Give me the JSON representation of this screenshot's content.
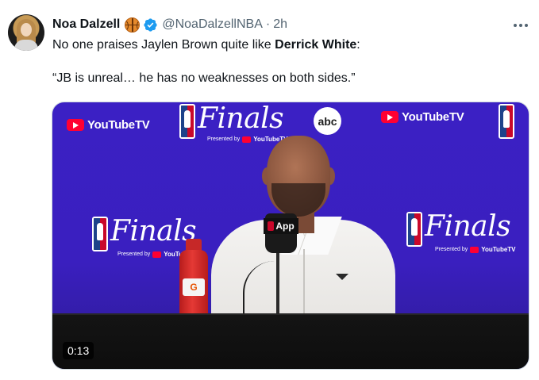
{
  "tweet": {
    "author": {
      "display_name": "Noa Dalzell",
      "handle": "@NoaDalzellNBA",
      "emoji": "basketball-icon",
      "verified": true
    },
    "timestamp": "2h",
    "separator": "·",
    "text_before_bold": "No one praises Jaylen Brown quite like ",
    "text_bold": "Derrick White",
    "text_after_bold": ":",
    "quote": "“JB is unreal… he has no weaknesses on both sides.”",
    "media": {
      "type": "video",
      "duration": "0:13",
      "backdrop": {
        "sponsor_label": "YouTubeTV",
        "event_label": "Finals",
        "presented_by": "Presented by",
        "network": "abc",
        "mic_label": "App",
        "bottle_mark": "G"
      }
    }
  },
  "colors": {
    "text_primary": "#0f1419",
    "text_secondary": "#536471",
    "verified_blue": "#1d9bf0",
    "backdrop_purple": "#3b20c4",
    "youtube_red": "#ff0033"
  }
}
